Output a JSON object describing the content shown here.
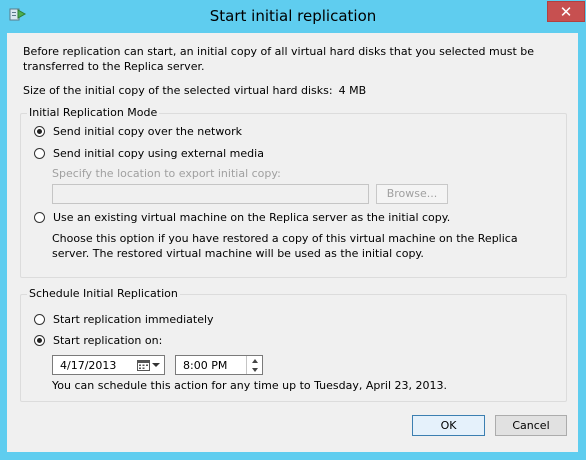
{
  "window": {
    "title": "Start initial replication",
    "close_glyph": "✕",
    "icon": "replication-app-icon"
  },
  "intro_text": "Before replication can start, an initial copy of all virtual hard disks that you selected must be transferred to the Replica server.",
  "size_label": "Size of the initial copy of the selected virtual hard disks:",
  "size_value": "4 MB",
  "mode_group": {
    "legend": "Initial Replication Mode",
    "option_network": "Send initial copy over the network",
    "option_media": "Send initial copy using external media",
    "export_location_label": "Specify the location to export initial copy:",
    "export_location_value": "",
    "browse_label": "Browse...",
    "option_existing": "Use an existing virtual machine on the Replica server as the initial copy.",
    "existing_help": "Choose this option if you have restored a copy of this virtual machine on the Replica server. The restored virtual machine  will be used as the initial copy.",
    "selected": "network"
  },
  "schedule_group": {
    "legend": "Schedule Initial Replication",
    "option_immediately": "Start replication immediately",
    "option_on": "Start replication on:",
    "date_value": "4/17/2013",
    "time_value": "8:00 PM",
    "schedule_note": "You can schedule this action for any time up to Tuesday, April 23, 2013.",
    "selected": "on"
  },
  "buttons": {
    "ok": "OK",
    "cancel": "Cancel"
  },
  "colors": {
    "frame": "#5fcdef",
    "close": "#c75050",
    "client": "#f0f0f0"
  }
}
